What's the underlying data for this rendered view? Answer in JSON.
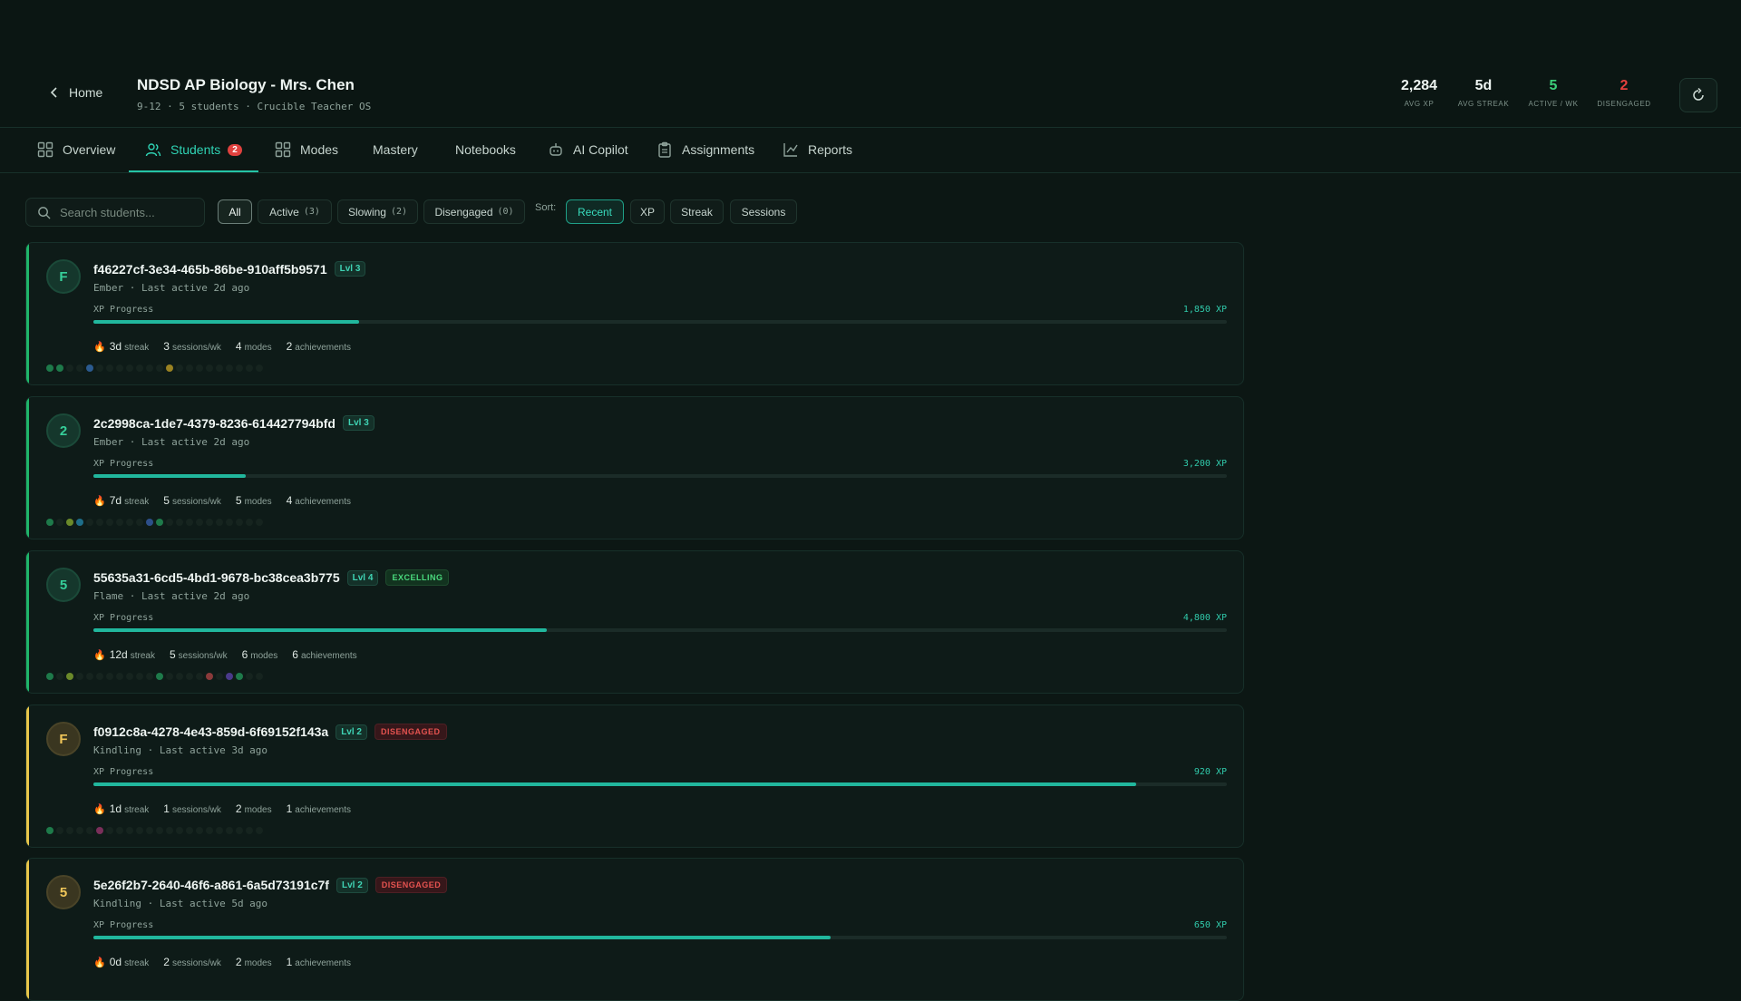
{
  "header": {
    "back_label": "Home",
    "title": "NDSD AP Biology - Mrs. Chen",
    "subtitle": "9-12 · 5 students · Crucible Teacher OS",
    "stats": [
      {
        "value": "2,284",
        "label": "AVG XP",
        "color": "#eef5f2"
      },
      {
        "value": "5d",
        "label": "AVG STREAK",
        "color": "#eef5f2"
      },
      {
        "value": "5",
        "label": "ACTIVE / WK",
        "color": "#3ccf7a"
      },
      {
        "value": "2",
        "label": "DISENGAGED",
        "color": "#e5403d"
      }
    ]
  },
  "tabs": [
    {
      "label": "Overview",
      "icon": "dashboard-icon"
    },
    {
      "label": "Students",
      "icon": "users-icon",
      "badge": "2",
      "active": true
    },
    {
      "label": "Modes",
      "icon": "grid-icon"
    },
    {
      "label": "Mastery",
      "icon": ""
    },
    {
      "label": "Notebooks",
      "icon": ""
    },
    {
      "label": "AI Copilot",
      "icon": "robot-icon"
    },
    {
      "label": "Assignments",
      "icon": "clipboard-icon"
    },
    {
      "label": "Reports",
      "icon": "chart-icon"
    }
  ],
  "filters": {
    "search_placeholder": "Search students...",
    "chips": [
      {
        "label": "All",
        "count": ""
      },
      {
        "label": "Active",
        "count": "(3)"
      },
      {
        "label": "Slowing",
        "count": "(2)"
      },
      {
        "label": "Disengaged",
        "count": "(0)"
      }
    ],
    "sort_label": "Sort:",
    "sort_options": [
      "Recent",
      "XP",
      "Streak",
      "Sessions"
    ]
  },
  "students": [
    {
      "initial": "F",
      "name": "f46227cf-3e34-465b-86be-910aff5b9571",
      "level": "Lvl 3",
      "tag": "",
      "status_line": "Ember · Last active 2d ago",
      "xp_label": "XP Progress",
      "xp": "1,850 XP",
      "xp_progress": 0.234,
      "streak": "3d",
      "streak_label": "streak",
      "sessions": "3",
      "sessions_label": "sessions/wk",
      "modes": "4",
      "modes_label": "modes",
      "achievements": "2",
      "achievements_label": "achievements",
      "accent": "#1fb56a",
      "tone": "green",
      "activity": [
        "#1e7a4a",
        "#1e7a4a",
        "",
        "",
        "#2b5a8f",
        "",
        "",
        "",
        "",
        "",
        "",
        "",
        "#9a8222",
        "",
        "",
        "",
        "",
        "",
        "",
        "",
        "",
        ""
      ]
    },
    {
      "initial": "2",
      "name": "2c2998ca-1de7-4379-8236-614427794bfd",
      "level": "Lvl 3",
      "tag": "",
      "status_line": "Ember · Last active 2d ago",
      "xp_label": "XP Progress",
      "xp": "3,200 XP",
      "xp_progress": 0.134,
      "streak": "7d",
      "streak_label": "streak",
      "sessions": "5",
      "sessions_label": "sessions/wk",
      "modes": "5",
      "modes_label": "modes",
      "achievements": "4",
      "achievements_label": "achievements",
      "accent": "#1fb56a",
      "tone": "green",
      "activity": [
        "#1e7a4a",
        "",
        "#6b8a2a",
        "#1e6e8a",
        "",
        "",
        "",
        "",
        "",
        "",
        "#2d4f8a",
        "#1e7a4a",
        "",
        "",
        "",
        "",
        "",
        "",
        "",
        "",
        "",
        ""
      ]
    },
    {
      "initial": "5",
      "name": "55635a31-6cd5-4bd1-9678-bc38cea3b775",
      "level": "Lvl 4",
      "tag": "EXCELLING",
      "status_line": "Flame · Last active 2d ago",
      "xp_label": "XP Progress",
      "xp": "4,800 XP",
      "xp_progress": 0.4,
      "streak": "12d",
      "streak_label": "streak",
      "sessions": "5",
      "sessions_label": "sessions/wk",
      "modes": "6",
      "modes_label": "modes",
      "achievements": "6",
      "achievements_label": "achievements",
      "accent": "#1fb56a",
      "tone": "green",
      "activity": [
        "#1e7a4a",
        "",
        "#6b8a2a",
        "",
        "",
        "",
        "",
        "",
        "",
        "",
        "",
        "#1e7a4a",
        "",
        "",
        "",
        "",
        "#8a3a3a",
        "",
        "#4a3a8a",
        "#1e7a4a",
        "",
        ""
      ]
    },
    {
      "initial": "F",
      "name": "f0912c8a-4278-4e43-859d-6f69152f143a",
      "level": "Lvl 2",
      "tag": "DISENGAGED",
      "status_line": "Kindling · Last active 3d ago",
      "xp_label": "XP Progress",
      "xp": "920 XP",
      "xp_progress": 0.92,
      "streak": "1d",
      "streak_label": "streak",
      "sessions": "1",
      "sessions_label": "sessions/wk",
      "modes": "2",
      "modes_label": "modes",
      "achievements": "1",
      "achievements_label": "achievements",
      "accent": "#e8c64a",
      "tone": "amber",
      "activity": [
        "#1e7a4a",
        "",
        "",
        "",
        "",
        "#7a2f5a",
        "",
        "",
        "",
        "",
        "",
        "",
        "",
        "",
        "",
        "",
        "",
        "",
        "",
        "",
        "",
        ""
      ]
    },
    {
      "initial": "5",
      "name": "5e26f2b7-2640-46f6-a861-6a5d73191c7f",
      "level": "Lvl 2",
      "tag": "DISENGAGED",
      "status_line": "Kindling · Last active 5d ago",
      "xp_label": "XP Progress",
      "xp": "650 XP",
      "xp_progress": 0.65,
      "streak": "0d",
      "streak_label": "streak",
      "sessions": "2",
      "sessions_label": "sessions/wk",
      "modes": "2",
      "modes_label": "modes",
      "achievements": "1",
      "achievements_label": "achievements",
      "accent": "#e8c64a",
      "tone": "amber",
      "activity": []
    }
  ]
}
